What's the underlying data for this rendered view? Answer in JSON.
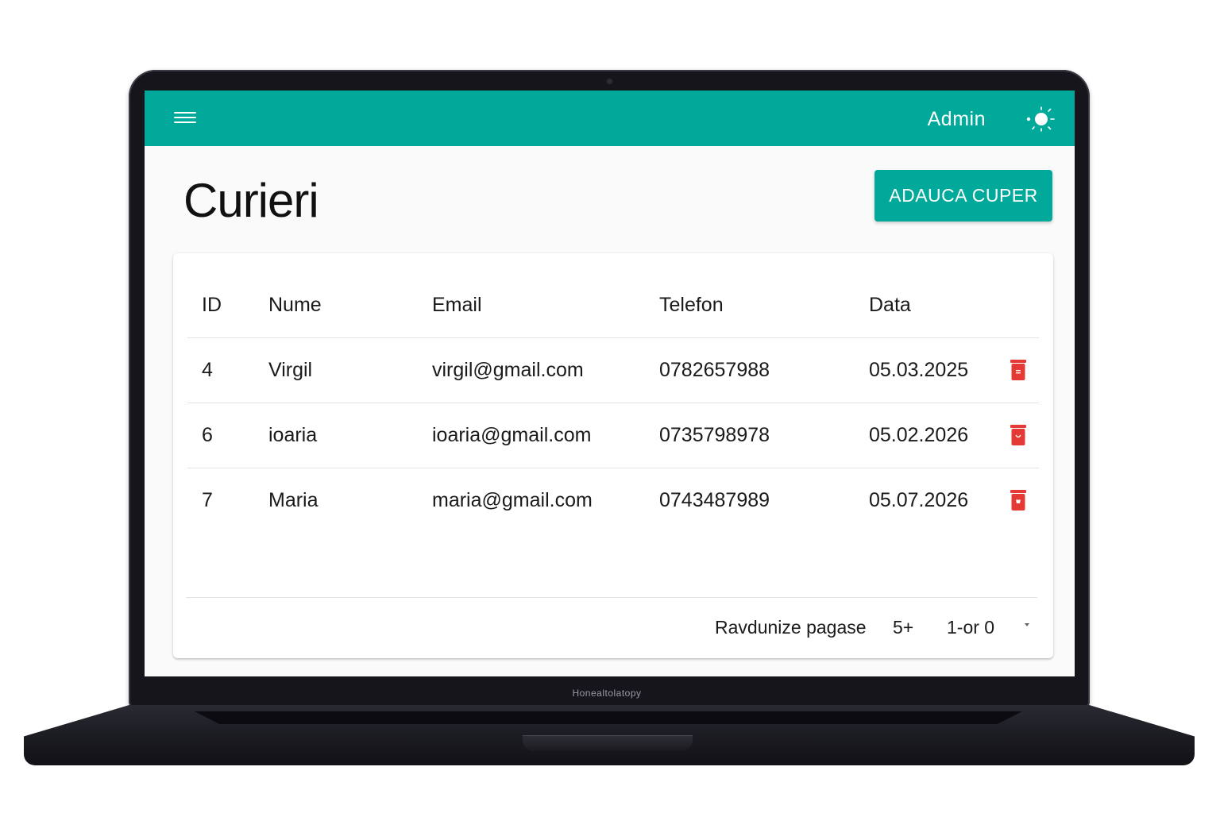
{
  "app": {
    "user_label": "Admin",
    "menu_icon": "hamburger-menu-icon",
    "theme_icon": "sun-icon",
    "accent_color": "#00a99a"
  },
  "page": {
    "title": "Curieri",
    "add_button_label": "ADAUCA CUPER"
  },
  "table": {
    "columns": [
      "ID",
      "Nume",
      "Email",
      "Telefon",
      "Data"
    ],
    "rows": [
      {
        "id": "4",
        "nume": "Virgil",
        "email": "virgil@gmail.com",
        "telefon": "0782657988",
        "data": "05.03.2025"
      },
      {
        "id": "6",
        "nume": "ioaria",
        "email": "ioaria@gmail.com",
        "telefon": "0735798978",
        "data": "05.02.2026"
      },
      {
        "id": "7",
        "nume": "Maria",
        "email": "maria@gmail.com",
        "telefon": "0743487989",
        "data": "05.07.2026"
      }
    ],
    "delete_icon": "trash-icon",
    "delete_color": "#e53935"
  },
  "pagination": {
    "rows_label": "Ravdunize pagase",
    "rows_value": "5+",
    "range_label": "1-or 0"
  },
  "device": {
    "brand_label": "Honealtolatopy"
  }
}
